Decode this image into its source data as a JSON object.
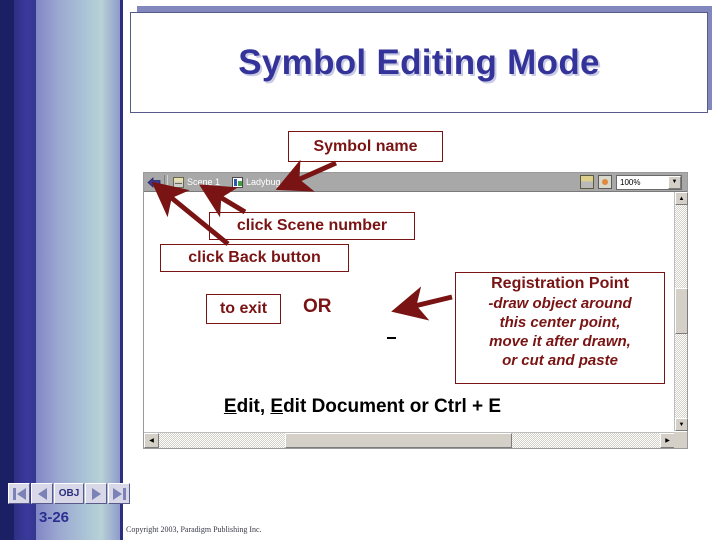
{
  "slide": {
    "title": "Symbol Editing Mode",
    "slide_number": "3-26",
    "copyright": "Copyright 2003, Paradigm Publishing Inc.",
    "title_color": "#33339a",
    "callout_color": "#7a1414"
  },
  "flash_window": {
    "toolbar": {
      "back_icon": "back-arrow-icon",
      "scene_item": {
        "icon": "scene-icon",
        "label": "Scene 1"
      },
      "symbol_item": {
        "icon": "symbol-icon",
        "label": "Ladybug"
      },
      "edit_scene_icon": "edit-scene-icon",
      "edit_symbol_icon": "edit-symbol-icon",
      "zoom_value": "100%",
      "zoom_dropdown_icon": "chevron-down-icon"
    },
    "scrollbars": {
      "v_up_icon": "scroll-up-icon",
      "v_down_icon": "scroll-down-icon",
      "h_left_icon": "scroll-left-icon",
      "h_right_icon": "scroll-right-icon"
    }
  },
  "callouts": {
    "symbol_name": "Symbol name",
    "scene_number": "click Scene number",
    "back_button": "click Back button",
    "to_exit": "to exit",
    "or": "OR",
    "registration": {
      "heading": "Registration Point",
      "line1": "-draw object around",
      "line2": "this center point,",
      "line3": "move it after drawn,",
      "line4": "or cut and paste"
    }
  },
  "edit_line": {
    "part1_underlined": "E",
    "part1_rest": "dit, ",
    "part2_underlined": "E",
    "part2_rest": "dit Document or Ctrl + E"
  },
  "nav": {
    "first_label": "first-slide",
    "prev_label": "previous-slide",
    "obj_label": "OBJ",
    "next_label": "next-slide",
    "last_label": "last-slide"
  }
}
